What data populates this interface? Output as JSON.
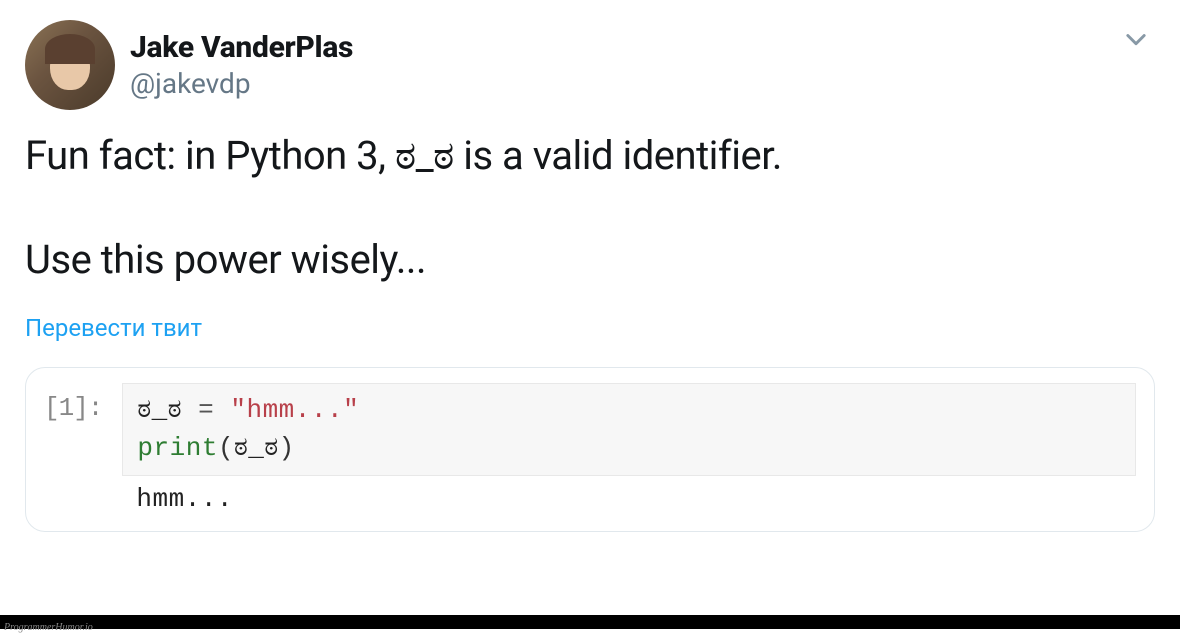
{
  "tweet": {
    "author": {
      "display_name": "Jake VanderPlas",
      "handle": "@jakevdp"
    },
    "body": {
      "line1": "Fun fact: in Python 3, ಠ_ಠ is a valid identifier.",
      "line2": "Use this power wisely..."
    },
    "translate_label": "Перевести твит"
  },
  "code": {
    "prompt": "[1]:",
    "line1": {
      "identifier": "ಠ_ಠ",
      "operator": " = ",
      "string": "\"hmm...\""
    },
    "line2": {
      "func": "print",
      "open": "(",
      "arg": "ಠ_ಠ",
      "close": ")"
    },
    "output": "hmm..."
  },
  "watermark": "ProgrammerHumor.io"
}
